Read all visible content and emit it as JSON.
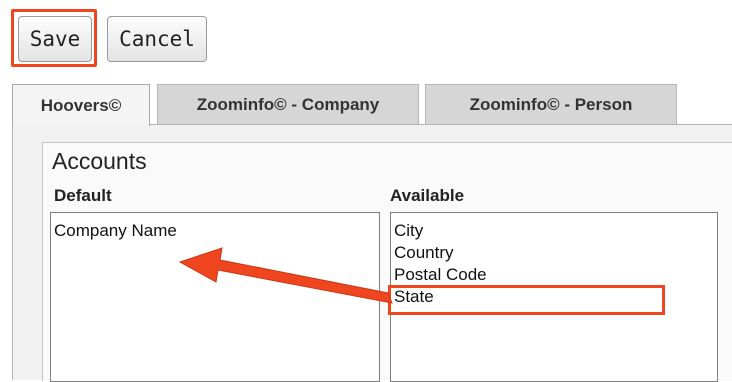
{
  "toolbar": {
    "save_label": "Save",
    "cancel_label": "Cancel"
  },
  "tabs": [
    {
      "label": "Hoovers©",
      "active": true
    },
    {
      "label": "Zoominfo© - Company",
      "active": false
    },
    {
      "label": "Zoominfo© - Person",
      "active": false
    }
  ],
  "section": {
    "title": "Accounts",
    "default_label": "Default",
    "available_label": "Available"
  },
  "default_list": [
    "Company Name"
  ],
  "available_list": [
    "City",
    "Country",
    "Postal Code",
    "State"
  ],
  "colors": {
    "highlight": "#f0461f",
    "panel_bg": "#f1f1f1"
  }
}
